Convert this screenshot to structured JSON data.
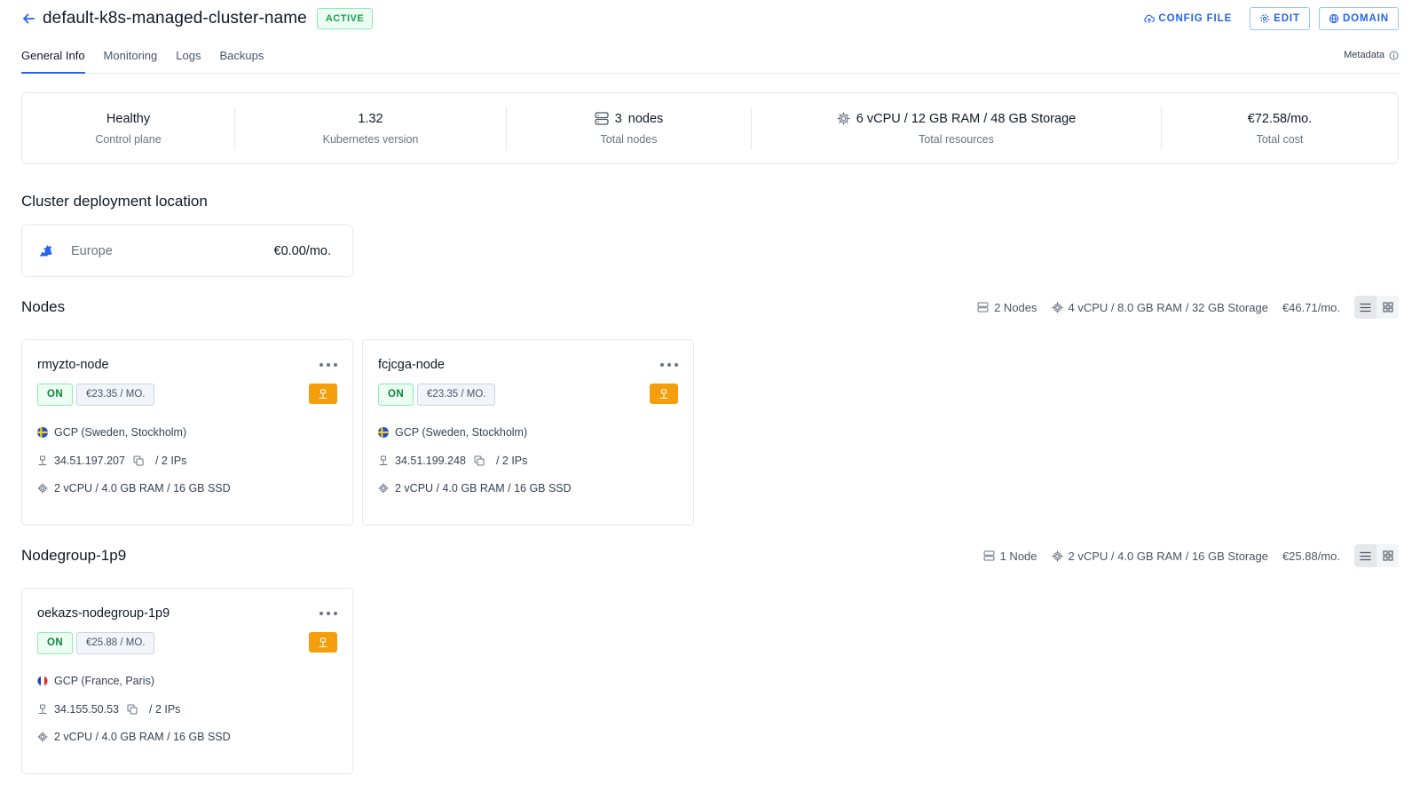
{
  "header": {
    "title": "default-k8s-managed-cluster-name",
    "status": "ACTIVE",
    "actions": {
      "config_file": "CONFIG FILE",
      "edit": "EDIT",
      "domain": "DOMAIN"
    }
  },
  "tabs": [
    "General Info",
    "Monitoring",
    "Logs",
    "Backups"
  ],
  "metadata_label": "Metadata",
  "summary": {
    "control_plane": {
      "value": "Healthy",
      "label": "Control plane"
    },
    "k8s_version": {
      "value": "1.32",
      "label": "Kubernetes version"
    },
    "total_nodes": {
      "count": "3",
      "unit": "nodes",
      "label": "Total nodes"
    },
    "resources": {
      "value": "6 vCPU / 12 GB RAM / 48 GB Storage",
      "label": "Total resources"
    },
    "cost": {
      "value": "€72.58/mo.",
      "label": "Total cost"
    }
  },
  "location": {
    "heading": "Cluster deployment location",
    "name": "Europe",
    "price": "€0.00/mo."
  },
  "groups": [
    {
      "name": "Nodes",
      "stats": {
        "nodes": "2 Nodes",
        "resources": "4 vCPU / 8.0 GB RAM / 32 GB Storage",
        "price": "€46.71/mo."
      },
      "nodes": [
        {
          "name": "rmyzto-node",
          "state": "ON",
          "price": "€23.35 / MO.",
          "location": "GCP (Sweden, Stockholm)",
          "flag": "sweden",
          "ip": "34.51.197.207",
          "ips": "/ 2 IPs",
          "spec": "2 vCPU / 4.0 GB RAM / 16 GB SSD"
        },
        {
          "name": "fcjcga-node",
          "state": "ON",
          "price": "€23.35 / MO.",
          "location": "GCP (Sweden, Stockholm)",
          "flag": "sweden",
          "ip": "34.51.199.248",
          "ips": "/ 2 IPs",
          "spec": "2 vCPU / 4.0 GB RAM / 16 GB SSD"
        }
      ]
    },
    {
      "name": "Nodegroup-1p9",
      "stats": {
        "nodes": "1 Node",
        "resources": "2 vCPU / 4.0 GB RAM / 16 GB Storage",
        "price": "€25.88/mo."
      },
      "nodes": [
        {
          "name": "oekazs-nodegroup-1p9",
          "state": "ON",
          "price": "€25.88 / MO.",
          "location": "GCP (France, Paris)",
          "flag": "france",
          "ip": "34.155.50.53",
          "ips": "/ 2 IPs",
          "spec": "2 vCPU / 4.0 GB RAM / 16 GB SSD"
        }
      ]
    }
  ],
  "colors": {
    "accent": "#2563eb",
    "success": "#16a34a",
    "warning": "#f59e0b",
    "border": "#e5e7eb"
  }
}
